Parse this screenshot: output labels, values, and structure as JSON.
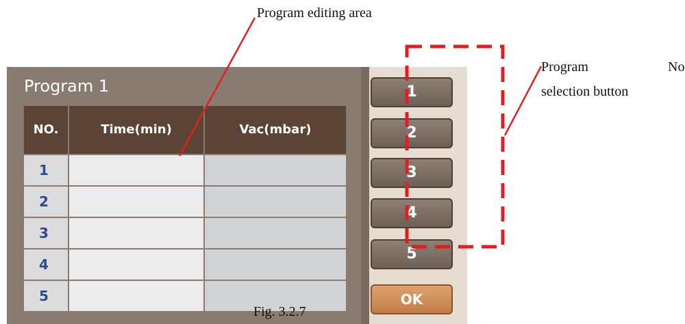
{
  "annotations": {
    "editing_area": "Program editing area",
    "program": "Program",
    "no": "No.",
    "selection_button": "selection button"
  },
  "caption": "Fig. 3.2.7",
  "panel": {
    "title": "Program 1",
    "headers": [
      "NO.",
      "Time(min)",
      "Vac(mbar)"
    ],
    "rows": [
      {
        "no": "1",
        "time": "",
        "vac": ""
      },
      {
        "no": "2",
        "time": "",
        "vac": ""
      },
      {
        "no": "3",
        "time": "",
        "vac": ""
      },
      {
        "no": "4",
        "time": "",
        "vac": ""
      },
      {
        "no": "5",
        "time": "",
        "vac": ""
      }
    ]
  },
  "buttons": [
    "1",
    "2",
    "3",
    "4",
    "5"
  ],
  "ok_label": "OK",
  "colors": {
    "panel_bg": "#8a7b70",
    "header_bg": "#5b4436",
    "annotation_red": "#e02020",
    "ok_button": "#d08c55"
  }
}
